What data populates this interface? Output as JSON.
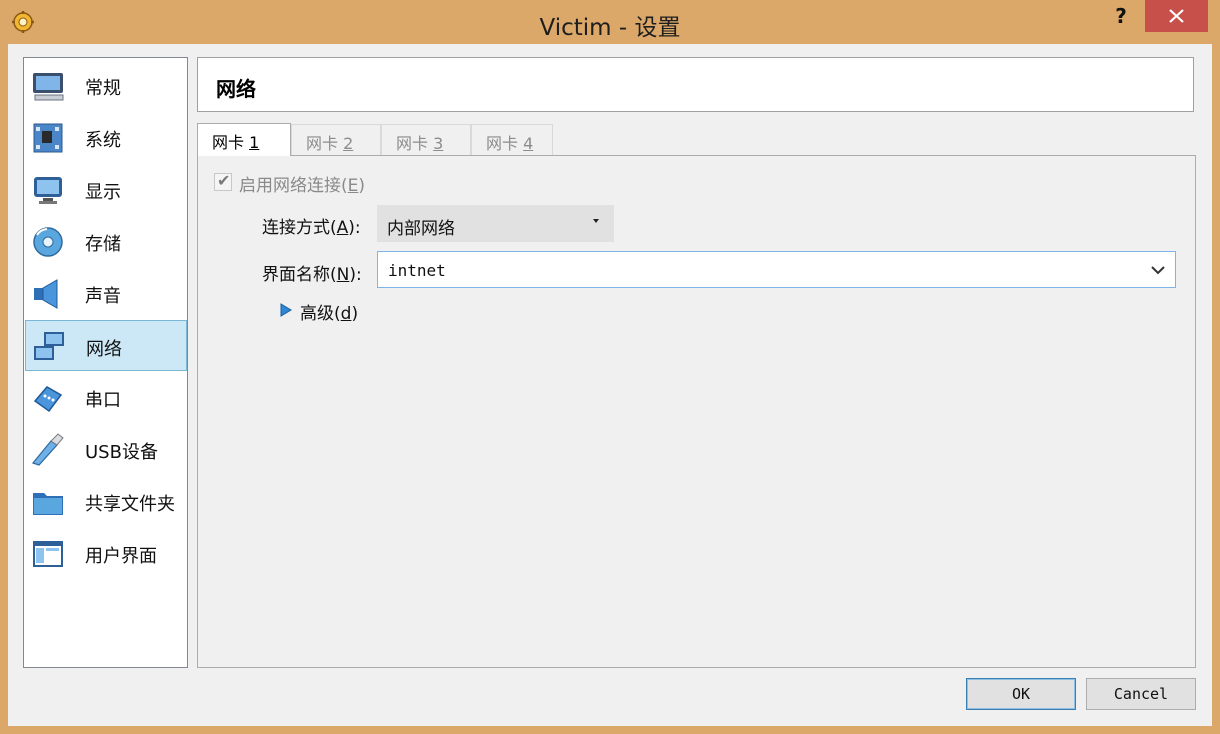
{
  "window": {
    "title": "Victim - 设置",
    "help_label": "?",
    "icons": {
      "app": "gear-icon",
      "close": "close-icon",
      "help": "help-icon"
    }
  },
  "sidebar": {
    "items": [
      {
        "label": "常规",
        "icon": "computer-general-icon"
      },
      {
        "label": "系统",
        "icon": "system-board-icon"
      },
      {
        "label": "显示",
        "icon": "display-monitor-icon"
      },
      {
        "label": "存储",
        "icon": "storage-disk-icon"
      },
      {
        "label": "声音",
        "icon": "speaker-icon"
      },
      {
        "label": "网络",
        "icon": "network-icon",
        "selected": true
      },
      {
        "label": "串口",
        "icon": "serial-port-icon"
      },
      {
        "label": "USB设备",
        "icon": "usb-icon"
      },
      {
        "label": "共享文件夹",
        "icon": "shared-folder-icon"
      },
      {
        "label": "用户界面",
        "icon": "user-interface-icon"
      }
    ]
  },
  "section": {
    "title": "网络"
  },
  "tabs": [
    {
      "prefix": "网卡 ",
      "mnemonic": "1",
      "active": true
    },
    {
      "prefix": "网卡 ",
      "mnemonic": "2"
    },
    {
      "prefix": "网卡 ",
      "mnemonic": "3"
    },
    {
      "prefix": "网卡 ",
      "mnemonic": "4"
    }
  ],
  "adapter": {
    "enable_label_prefix": "启用网络连接(",
    "enable_mnemonic": "E",
    "enable_label_suffix": ")",
    "enabled": true,
    "attached_label_prefix": "连接方式(",
    "attached_mnemonic": "A",
    "attached_label_suffix": "):",
    "attached_value": "内部网络",
    "name_label_prefix": "界面名称(",
    "name_mnemonic": "N",
    "name_label_suffix": "):",
    "name_value": "intnet",
    "advanced_prefix": "高级(",
    "advanced_mnemonic": "d",
    "advanced_suffix": ")"
  },
  "buttons": {
    "ok": "OK",
    "cancel": "Cancel"
  },
  "colors": {
    "title_bar": "#dba869",
    "selection": "#cce8f6",
    "close_button": "#c7504a"
  }
}
